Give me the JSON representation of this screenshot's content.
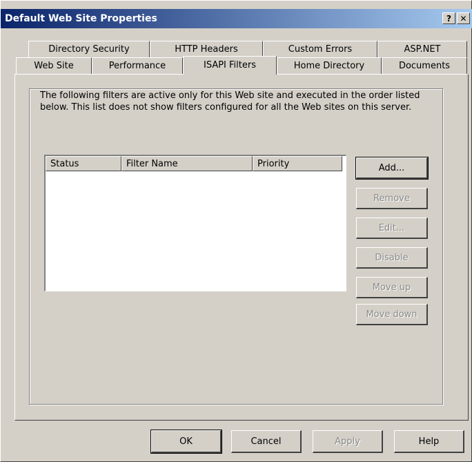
{
  "window": {
    "title": "Default Web Site Properties",
    "help_btn": "?",
    "close_btn": "✕"
  },
  "tabs_row1": [
    "Directory Security",
    "HTTP Headers",
    "Custom Errors",
    "ASP.NET"
  ],
  "tabs_row2": [
    "Web Site",
    "Performance",
    "ISAPI Filters",
    "Home Directory",
    "Documents"
  ],
  "active_tab": "ISAPI Filters",
  "description": "The following filters are active only for this Web site and executed in the order listed below. This list does not show filters configured for all the Web sites on this server.",
  "list": {
    "columns": [
      "Status",
      "Filter Name",
      "Priority"
    ],
    "rows": []
  },
  "actions": {
    "add": "Add...",
    "remove": "Remove",
    "edit": "Edit...",
    "disable": "Disable",
    "move_up": "Move up",
    "move_down": "Move down"
  },
  "footer": {
    "ok": "OK",
    "cancel": "Cancel",
    "apply": "Apply",
    "help": "Help"
  }
}
